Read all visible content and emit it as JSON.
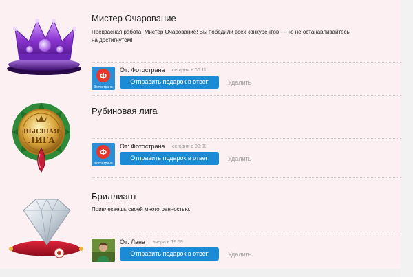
{
  "gifts": [
    {
      "title": "Мистер Очарование",
      "message_line1": "Прекрасная работа, Мистер Очарование! Вы победили всех конкурентов — но не останавливайтесь",
      "message_line2": "на достигнутом!",
      "from_label": "От:",
      "sender": "Фотострана",
      "time": "сегодня в 00:11",
      "reply_label": "Отправить подарок в ответ",
      "delete_label": "Удалить",
      "icon": "crown-icon"
    },
    {
      "title": "Рубиновая лига",
      "message_line1": "",
      "message_line2": "",
      "from_label": "От:",
      "sender": "Фотострана",
      "time": "сегодня в 00:00",
      "reply_label": "Отправить подарок в ответ",
      "delete_label": "Удалить",
      "icon": "league-medal-icon",
      "medal_text_1": "ВЫСШАЯ",
      "medal_text_2": "ЛИГА"
    },
    {
      "title": "Бриллиант",
      "message_line1": "Привлекаешь своей многогранностью.",
      "message_line2": "",
      "from_label": "От:",
      "sender": "Лана",
      "time": "вчера в 19:59",
      "reply_label": "Отправить подарок в ответ",
      "delete_label": "Удалить",
      "icon": "diamond-icon"
    }
  ],
  "fotostrana_avatar_letter": "Ф",
  "fotostrana_avatar_caption": "Фотострана",
  "colors": {
    "panel_bg": "#fcf0f3",
    "button_bg": "#1b8bd6",
    "button_text": "#ffffff",
    "delete_text": "#a0a0a0",
    "time_text": "#999999"
  }
}
